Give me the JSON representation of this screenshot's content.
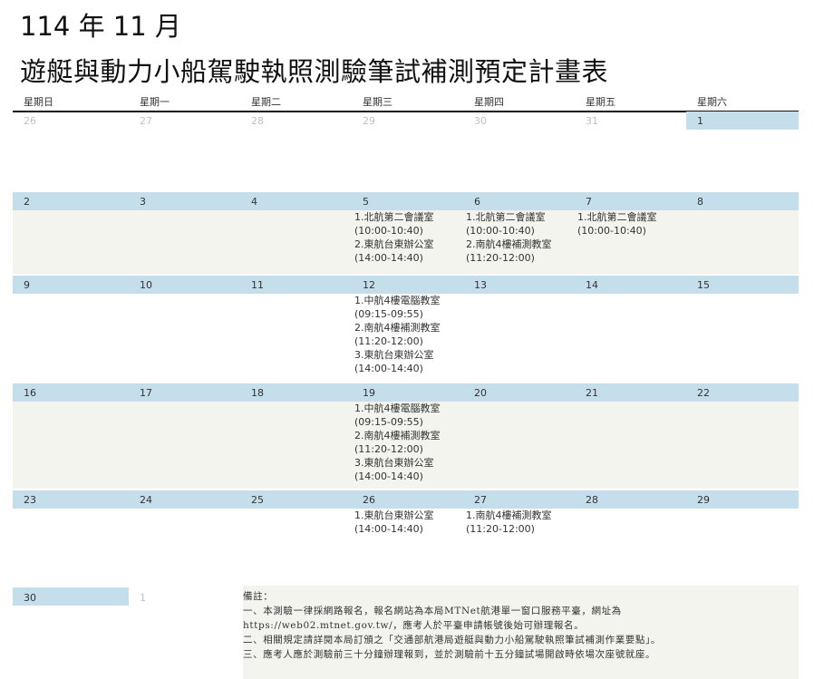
{
  "header": {
    "month": "114 年 11 月",
    "title": "遊艇與動力小船駕駛執照測驗筆試補測預定計畫表"
  },
  "weekdays": [
    "星期日",
    "星期一",
    "星期二",
    "星期三",
    "星期四",
    "星期五",
    "星期六"
  ],
  "weeks": [
    {
      "days": [
        {
          "num": "26",
          "muted": true,
          "events": []
        },
        {
          "num": "27",
          "muted": true,
          "events": []
        },
        {
          "num": "28",
          "muted": true,
          "events": []
        },
        {
          "num": "29",
          "muted": true,
          "events": []
        },
        {
          "num": "30",
          "muted": true,
          "events": []
        },
        {
          "num": "31",
          "muted": true,
          "events": []
        },
        {
          "num": "1",
          "muted": false,
          "events": []
        }
      ]
    },
    {
      "days": [
        {
          "num": "2",
          "events": []
        },
        {
          "num": "3",
          "events": []
        },
        {
          "num": "4",
          "events": []
        },
        {
          "num": "5",
          "events": [
            "1.北航第二會議室",
            "(10:00-10:40)",
            "2.東航台東辦公室",
            "(14:00-14:40)"
          ]
        },
        {
          "num": "6",
          "events": [
            "1.北航第二會議室",
            "(10:00-10:40)",
            "2.南航4樓補測教室",
            "(11:20-12:00)"
          ]
        },
        {
          "num": "7",
          "events": [
            "1.北航第二會議室",
            "(10:00-10:40)"
          ]
        },
        {
          "num": "8",
          "events": []
        }
      ]
    },
    {
      "days": [
        {
          "num": "9",
          "events": []
        },
        {
          "num": "10",
          "events": []
        },
        {
          "num": "11",
          "events": []
        },
        {
          "num": "12",
          "events": [
            "1.中航4樓電腦教室",
            "(09:15-09:55)",
            "2.南航4樓補測教室",
            "(11:20-12:00)",
            "3.東航台東辦公室",
            "(14:00-14:40)"
          ]
        },
        {
          "num": "13",
          "events": []
        },
        {
          "num": "14",
          "events": []
        },
        {
          "num": "15",
          "events": []
        }
      ]
    },
    {
      "days": [
        {
          "num": "16",
          "events": []
        },
        {
          "num": "17",
          "events": []
        },
        {
          "num": "18",
          "events": []
        },
        {
          "num": "19",
          "events": [
            "1.中航4樓電腦教室",
            "(09:15-09:55)",
            "2.南航4樓補測教室",
            "(11:20-12:00)",
            "3.東航台東辦公室",
            "(14:00-14:40)"
          ]
        },
        {
          "num": "20",
          "events": []
        },
        {
          "num": "21",
          "events": []
        },
        {
          "num": "22",
          "events": []
        }
      ]
    },
    {
      "days": [
        {
          "num": "23",
          "events": []
        },
        {
          "num": "24",
          "events": []
        },
        {
          "num": "25",
          "events": []
        },
        {
          "num": "26",
          "events": [
            "1.東航台東辦公室",
            "(14:00-14:40)"
          ]
        },
        {
          "num": "27",
          "events": [
            "1.南航4樓補測教室",
            "(11:20-12:00)"
          ]
        },
        {
          "num": "28",
          "events": []
        },
        {
          "num": "29",
          "events": []
        }
      ]
    }
  ],
  "last_row": {
    "day30": "30",
    "day1_next": "1"
  },
  "notes": {
    "heading": "備註：",
    "lines": [
      "一、本測驗一律採網路報名，報名網站為本局MTNet航港單一窗口服務平臺，網址為",
      "https://web02.mtnet.gov.tw/，應考人於平臺申請帳號後始可辦理報名。",
      "二、相關規定請詳閱本局訂頒之「交通部航港局遊艇與動力小船駕駛執照筆試補測作業要點」。",
      "三、應考人應於測驗前三十分鐘辦理報到，並於測驗前十五分鐘試場開啟時依場次座號就座。"
    ]
  }
}
